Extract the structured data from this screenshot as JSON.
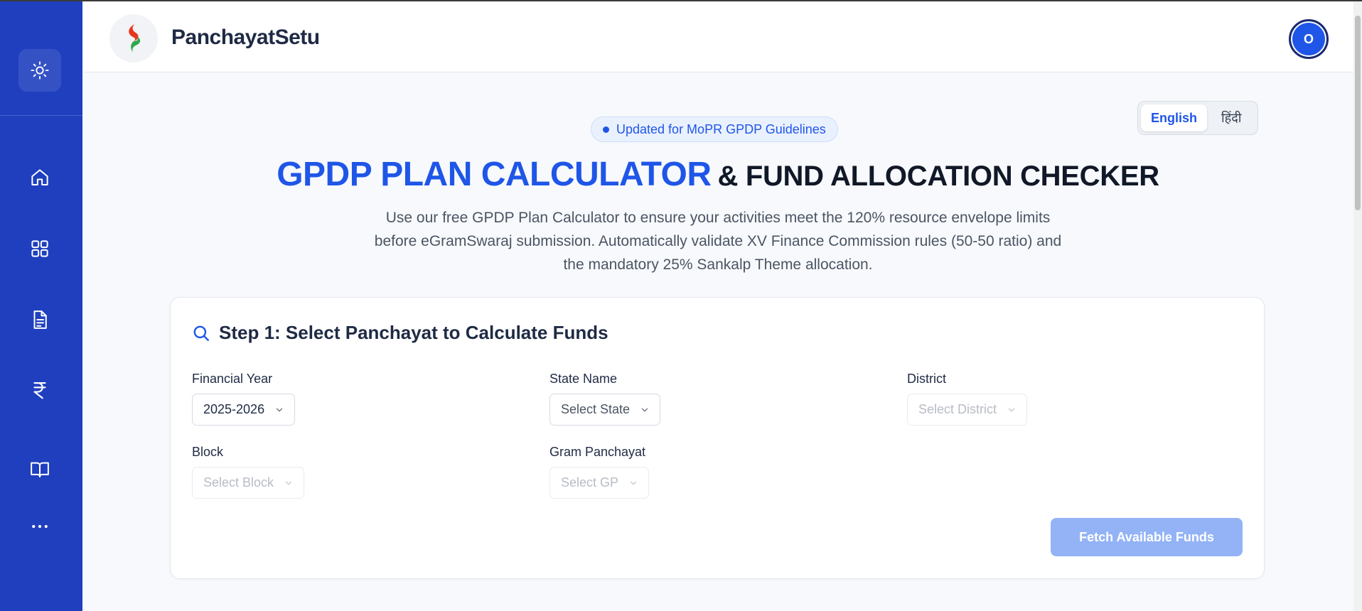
{
  "app": {
    "brand": "PanchayatSetu",
    "avatar_initial": "O"
  },
  "sidebar": {
    "items": [
      {
        "icon": "home-icon"
      },
      {
        "icon": "grid-icon"
      },
      {
        "icon": "document-icon"
      },
      {
        "icon": "rupee-icon"
      },
      {
        "icon": "book-icon"
      },
      {
        "icon": "more-icon"
      }
    ],
    "theme_icon": "sun-icon"
  },
  "language": {
    "options": [
      "English",
      "हिंदी"
    ],
    "selected": "English"
  },
  "hero": {
    "badge": "Updated for MoPR GPDP Guidelines",
    "title_highlight": "GPDP PLAN CALCULATOR",
    "title_rest": "& FUND ALLOCATION CHECKER",
    "description": "Use our free GPDP Plan Calculator to ensure your activities meet the 120% resource envelope limits before eGramSwaraj submission. Automatically validate XV Finance Commission rules (50-50 ratio) and the mandatory 25% Sankalp Theme allocation."
  },
  "step1": {
    "title": "Step 1: Select Panchayat to Calculate Funds",
    "fields": {
      "financial_year": {
        "label": "Financial Year",
        "value": "2025-2026"
      },
      "state": {
        "label": "State Name",
        "placeholder": "Select State"
      },
      "district": {
        "label": "District",
        "placeholder": "Select District"
      },
      "block": {
        "label": "Block",
        "placeholder": "Select Block"
      },
      "gram_panchayat": {
        "label": "Gram Panchayat",
        "placeholder": "Select GP"
      }
    },
    "fetch_button": "Fetch Available Funds"
  },
  "colors": {
    "sidebar": "#1f3fbf",
    "accent": "#1f56e8",
    "button_disabled": "#93b3f6"
  }
}
